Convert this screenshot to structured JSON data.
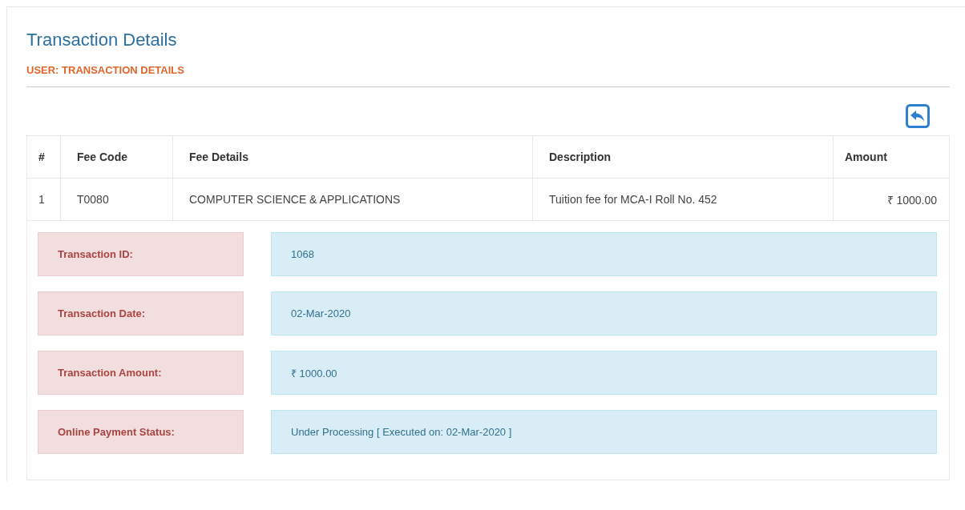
{
  "page": {
    "title": "Transaction Details",
    "breadcrumb": "USER: TRANSACTION DETAILS"
  },
  "table": {
    "columns": [
      "#",
      "Fee Code",
      "Fee Details",
      "Description",
      "Amount"
    ],
    "rows": [
      [
        "1",
        "T0080",
        "COMPUTER SCIENCE & APPLICATIONS",
        "Tuition fee for MCA-I Roll No. 452",
        "₹ 1000.00"
      ]
    ]
  },
  "details": [
    {
      "label": "Transaction ID:",
      "value": "1068"
    },
    {
      "label": "Transaction Date:",
      "value": "02-Mar-2020"
    },
    {
      "label": "Transaction Amount:",
      "value": "₹ 1000.00"
    },
    {
      "label": "Online Payment Status:",
      "value": "Under Processing [ Executed on: 02-Mar-2020 ]"
    }
  ]
}
